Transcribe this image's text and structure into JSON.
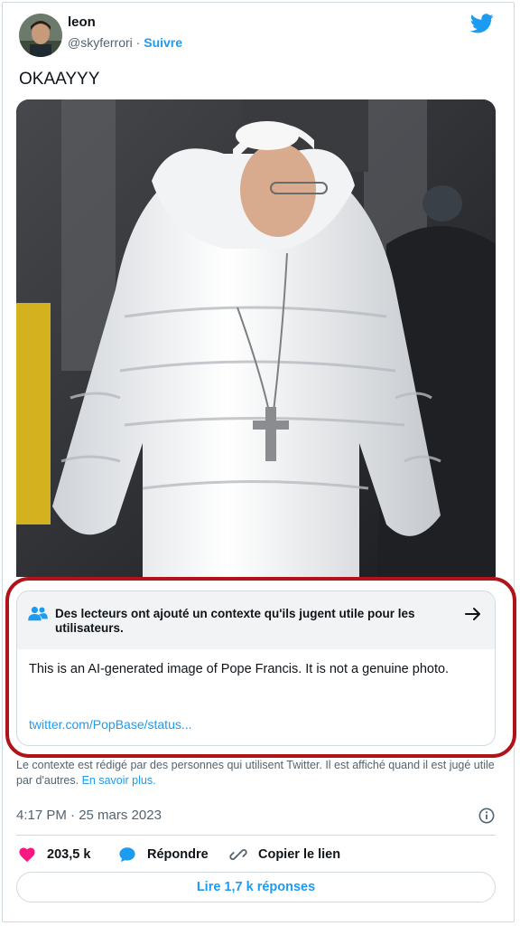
{
  "author": {
    "name": "leon",
    "handle": "@skyferrori",
    "separator": "·",
    "follow_label": "Suivre"
  },
  "tweet": {
    "text": "OKAAYYY",
    "photo_alt": "AI-generated image of Pope Francis in a white puffer coat"
  },
  "community_note": {
    "title": "Des lecteurs ont ajouté un contexte qu'ils jugent utile pour les utilisateurs.",
    "body": "This is an AI-generated image of Pope Francis. It is not a genuine photo.",
    "link": "twitter.com/PopBase/status..."
  },
  "disclaimer": {
    "text": "Le contexte est rédigé par des personnes qui utilisent Twitter. Il est affiché quand il est jugé utile par d'autres.",
    "link": "En savoir plus."
  },
  "meta": {
    "timestamp": "4:17 PM · 25 mars 2023"
  },
  "actions": {
    "likes": "203,5 k",
    "reply_label": "Répondre",
    "copy_label": "Copier le lien",
    "read_replies_label": "Lire 1,7 k réponses"
  },
  "colors": {
    "brand": "#1d9bf0",
    "like": "#f91880",
    "highlight_outline": "#b0141a"
  },
  "icons": [
    "twitter-bird-icon",
    "people-icon",
    "arrow-right-icon",
    "info-icon",
    "heart-icon",
    "reply-bubble-icon",
    "link-icon"
  ]
}
